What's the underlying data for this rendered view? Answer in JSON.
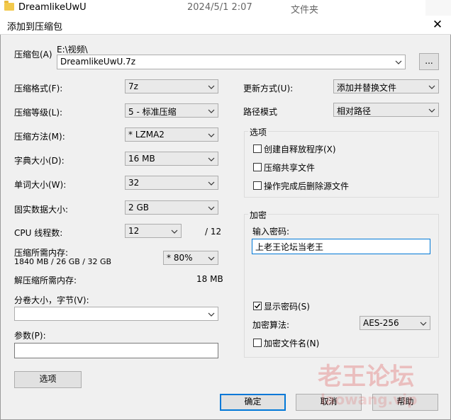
{
  "background_row": {
    "name": "DreamlikeUwU",
    "date": "2024/5/1 2:07",
    "type": "文件夹"
  },
  "dialog": {
    "title": "添加到压缩包",
    "close_glyph": "✕"
  },
  "archive": {
    "label": "压缩包(A)",
    "path": "E:\\视频\\",
    "name": "DreamlikeUwU.7z",
    "browse_label": "..."
  },
  "left": {
    "format": {
      "label": "压缩格式(F):",
      "value": "7z"
    },
    "level": {
      "label": "压缩等级(L):",
      "value": "5 - 标准压缩"
    },
    "method": {
      "label": "压缩方法(M):",
      "value": "*  LZMA2"
    },
    "dict": {
      "label": "字典大小(D):",
      "value": "16 MB"
    },
    "word": {
      "label": "单词大小(W):",
      "value": "32"
    },
    "solid": {
      "label": "固实数据大小:",
      "value": "2 GB"
    },
    "threads": {
      "label": "CPU 线程数:",
      "value": "12",
      "max": "/ 12"
    },
    "memory": {
      "label": "压缩所需内存:",
      "detail": "1840 MB / 26 GB / 32 GB",
      "value": "* 80%"
    },
    "decompress": {
      "label": "解压缩所需内存:",
      "value": "18 MB"
    },
    "split": {
      "label": "分卷大小，字节(V):",
      "value": ""
    },
    "params": {
      "label": "参数(P):",
      "value": ""
    },
    "options_button": "选项"
  },
  "right": {
    "update": {
      "label": "更新方式(U):",
      "value": "添加并替换文件"
    },
    "path_mode": {
      "label": "路径模式",
      "value": "相对路径"
    },
    "options_group": {
      "title": "选项",
      "items": [
        {
          "label": "创建自释放程序(X)",
          "checked": false
        },
        {
          "label": "压缩共享文件",
          "checked": false
        },
        {
          "label": "操作完成后删除源文件",
          "checked": false
        }
      ]
    },
    "encryption": {
      "title": "加密",
      "password_label": "输入密码:",
      "password_value": "上老王论坛当老王",
      "show_password": {
        "label": "显示密码(S)",
        "checked": true
      },
      "method_label": "加密算法:",
      "method_value": "AES-256",
      "encrypt_names": {
        "label": "加密文件名(N)",
        "checked": false
      }
    }
  },
  "buttons": {
    "ok": "确定",
    "cancel": "取消",
    "help": "帮助"
  },
  "watermark": {
    "main": "老王论坛",
    "sub": "laowang.vip"
  },
  "colors": {
    "accent": "#0078d7",
    "folder": "#f2c94c",
    "watermark": "#dc3c3c"
  }
}
